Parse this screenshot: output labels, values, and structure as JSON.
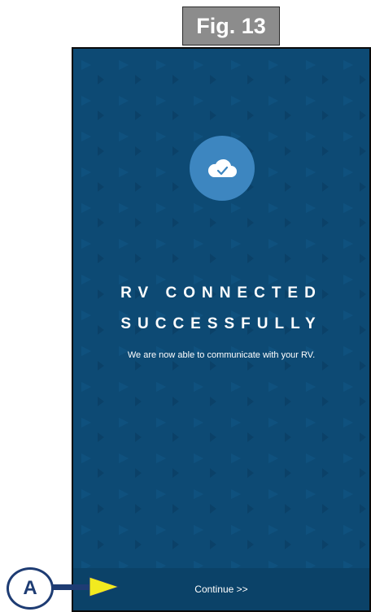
{
  "figure": {
    "label": "Fig. 13"
  },
  "screen": {
    "icon": "cloud-check-icon",
    "title_line1": "RV CONNECTED",
    "title_line2": "SUCCESSFULLY",
    "subtitle": "We are now able to communicate with your RV.",
    "continue_label": "Continue >>"
  },
  "callout": {
    "letter": "A",
    "color": "#1e3c73",
    "arrow_color": "#f2ea1f"
  },
  "colors": {
    "background": "#0d4a74",
    "accent": "#3d86c0"
  }
}
